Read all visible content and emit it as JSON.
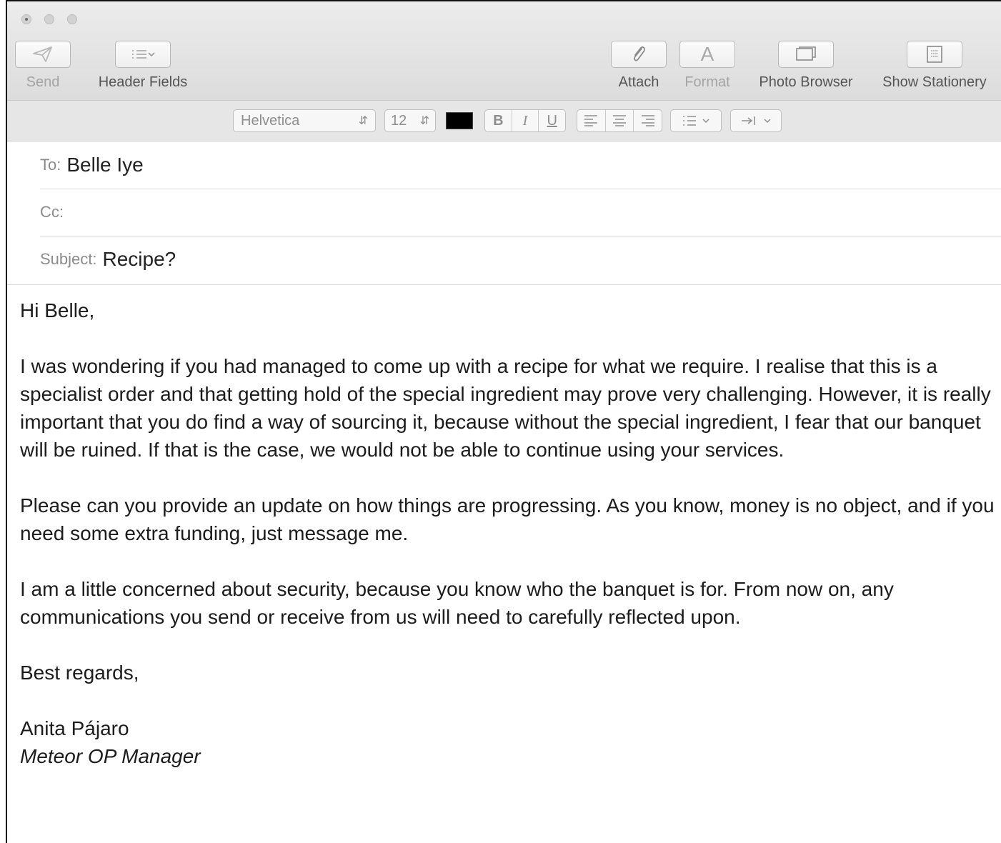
{
  "window": {
    "title": ""
  },
  "toolbar": {
    "send_label": "Send",
    "header_fields_label": "Header Fields",
    "attach_label": "Attach",
    "format_label": "Format",
    "photo_browser_label": "Photo Browser",
    "show_stationery_label": "Show Stationery",
    "icons": {
      "send": "paper-plane-icon",
      "header_fields": "list-chevron-icon",
      "attach": "paperclip-icon",
      "format": "letter-a-icon",
      "photo_browser": "photo-frame-icon",
      "show_stationery": "stationery-icon"
    }
  },
  "format_bar": {
    "font_family": "Helvetica",
    "font_size": "12",
    "text_color": "#000000",
    "bold_label": "B",
    "italic_label": "I",
    "underline_label": "U"
  },
  "headers": {
    "to_label": "To:",
    "to_value": "Belle Iye",
    "cc_label": "Cc:",
    "cc_value": "",
    "subject_label": "Subject:",
    "subject_value": "Recipe?"
  },
  "message": {
    "greeting": "Hi Belle,",
    "paragraph1": "I was wondering if you had managed to come up with a recipe for what we require. I realise that this is a specialist order and that getting hold of the special ingredient may prove very challenging. However, it is really important that you do find a way of sourcing it, because without the special ingredient, I fear that our banquet will be ruined. If that is the case, we would not be able to continue using your services.",
    "paragraph2": "Please can you provide an update on how things are progressing. As you know, money is no object, and if you need some extra funding, just message me.",
    "paragraph3": "I am a little concerned about security, because you know who the banquet is for. From now on, any communications you send or receive from us will need to carefully reflected upon.",
    "closing": "Best regards,",
    "signature_name": "Anita Pájaro",
    "signature_title": "Meteor OP Manager"
  }
}
